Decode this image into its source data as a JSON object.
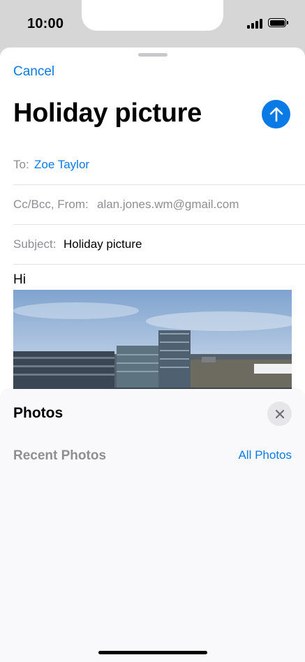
{
  "status_bar": {
    "time": "10:00"
  },
  "compose": {
    "cancel_label": "Cancel",
    "title": "Holiday picture",
    "to_label": "To:",
    "to_value": "Zoe Taylor",
    "cc_label": "Cc/Bcc, From:",
    "cc_value": "alan.jones.wm@gmail.com",
    "subject_label": "Subject:",
    "subject_value": "Holiday picture",
    "body_text": "Hi"
  },
  "photos_panel": {
    "title": "Photos",
    "recent_label": "Recent Photos",
    "all_photos_label": "All Photos"
  },
  "colors": {
    "accent": "#0a7ae6",
    "secondary_text": "#8e8e93"
  }
}
